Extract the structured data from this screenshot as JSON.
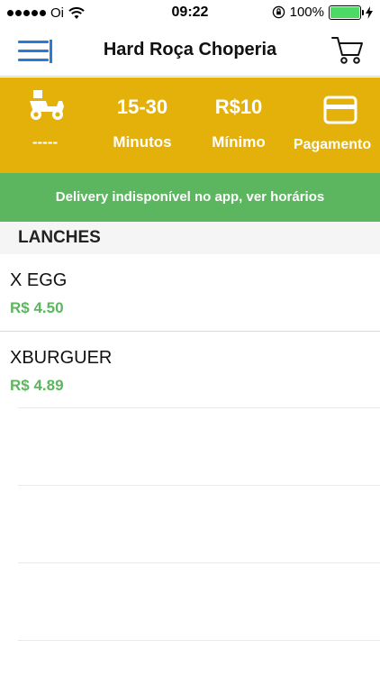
{
  "status_bar": {
    "carrier": "Oi",
    "time": "09:22",
    "battery": "100%",
    "signal_bars": 5,
    "battery_level": 1.0,
    "battery_color": "#4cd964"
  },
  "nav": {
    "title": "Hard Roça Choperia",
    "menu_icon": "hamburger-icon",
    "cart_icon": "cart-icon",
    "menu_color": "#2a7bd6"
  },
  "info": {
    "background": "#e4b10a",
    "delivery": {
      "icon": "scooter-icon",
      "value": "-----"
    },
    "time": {
      "top": "15-30",
      "bottom": "Minutos"
    },
    "minimum": {
      "top": "R$10",
      "bottom": "Mínimo"
    },
    "payment": {
      "icon": "credit-card-icon",
      "bottom": "Pagamento"
    }
  },
  "notice": {
    "text": "Delivery indisponível no app, ver horários",
    "background": "#5cb55f"
  },
  "section": {
    "title": "LANCHES"
  },
  "products": [
    {
      "name": "X EGG",
      "price": "R$ 4.50"
    },
    {
      "name": "XBURGUER",
      "price": "R$ 4.89"
    }
  ],
  "price_color": "#5cb55f"
}
